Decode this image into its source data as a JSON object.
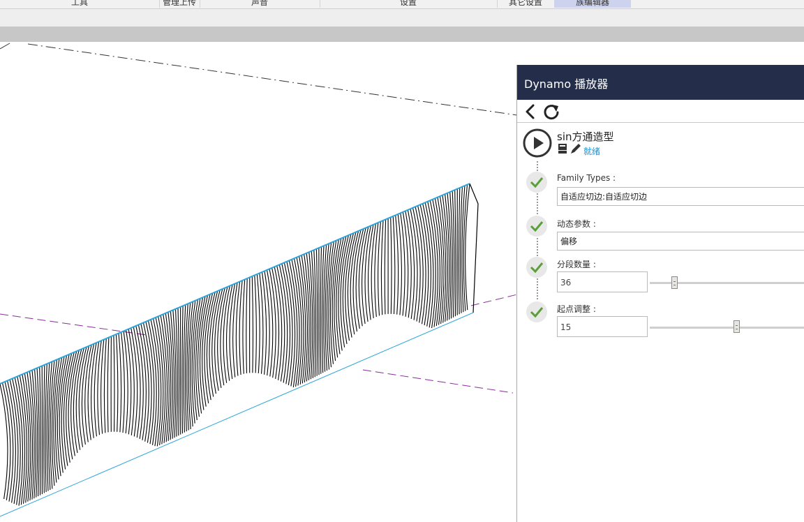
{
  "ribbon": {
    "tabs": [
      {
        "label": "工具",
        "active": false
      },
      {
        "label": "管理上传",
        "active": false
      },
      {
        "label": "声音",
        "active": false
      },
      {
        "label": "设置",
        "active": false
      },
      {
        "label": "其它设置",
        "active": false
      },
      {
        "label": "族编辑器",
        "active": true
      }
    ]
  },
  "viewport": {
    "edge_color": "#2ba4de",
    "line_color": "#000000",
    "dash_color": "#8a2b9b"
  },
  "panel": {
    "title": "Dynamo 播放器",
    "header_color": "#242e4a",
    "nav": {
      "back_icon": "chevron-left-icon",
      "refresh_icon": "refresh-icon"
    },
    "script": {
      "name": "sin方通造型",
      "status": "就绪",
      "icons": [
        "script-file-icon",
        "pencil-icon"
      ]
    },
    "inputs": [
      {
        "label": "Family Types :",
        "value": "自适应切边:自适应切边",
        "type": "dropdown"
      },
      {
        "label": "动态参数 :",
        "value": "偏移",
        "type": "dropdown"
      },
      {
        "label": "分段数量 :",
        "value": "36",
        "type": "slider",
        "slider_fraction": 0.15
      },
      {
        "label": "起点调整 :",
        "value": "15",
        "type": "slider",
        "slider_fraction": 0.54
      }
    ],
    "check_color": "#5aa03a",
    "status_color": "#1a8fd4"
  }
}
